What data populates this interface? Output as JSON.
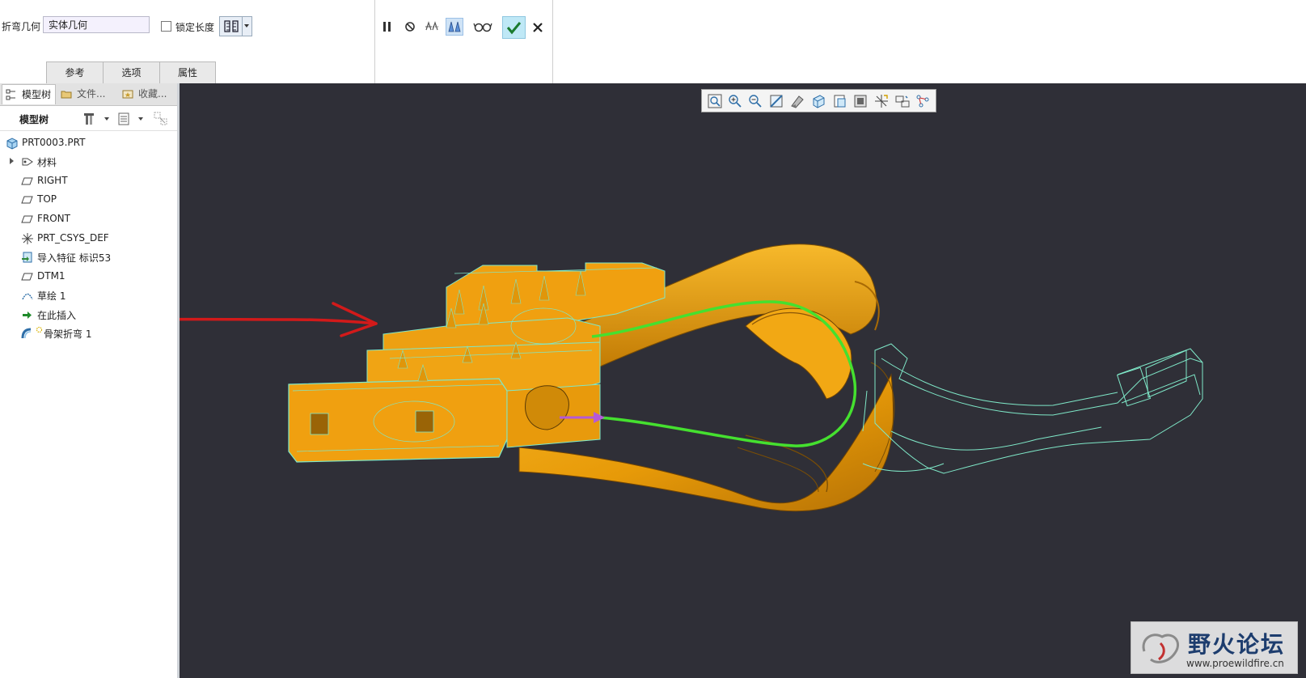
{
  "dashboard": {
    "geometry_label": "折弯几何",
    "geometry_value": "实体几何",
    "lock_length_label": "锁定长度",
    "tabs": [
      "参考",
      "选项",
      "属性"
    ]
  },
  "controls": {
    "pause": "pause-icon",
    "stop": "stop-icon",
    "preview": "preview-icon",
    "verify": "glasses-icon",
    "ok": "check-icon",
    "cancel": "close-icon"
  },
  "left_panel": {
    "tabs": [
      {
        "label": "模型树"
      },
      {
        "label": "文件..."
      },
      {
        "label": "收藏..."
      }
    ],
    "tree_header": "模型树",
    "tree_items": [
      {
        "label": "PRT0003.PRT",
        "icon": "part-icon"
      },
      {
        "label": "材料",
        "icon": "material-icon"
      },
      {
        "label": "RIGHT",
        "icon": "datum-plane-icon"
      },
      {
        "label": "TOP",
        "icon": "datum-plane-icon"
      },
      {
        "label": "FRONT",
        "icon": "datum-plane-icon"
      },
      {
        "label": "PRT_CSYS_DEF",
        "icon": "csys-icon"
      },
      {
        "label": "导入特征 标识53",
        "icon": "import-feature-icon"
      },
      {
        "label": "DTM1",
        "icon": "datum-plane-icon"
      },
      {
        "label": "草绘 1",
        "icon": "sketch-icon"
      },
      {
        "label": "在此插入",
        "icon": "insert-here-icon"
      },
      {
        "label": "骨架折弯 1",
        "icon": "spinal-bend-icon"
      }
    ]
  },
  "view_toolbar": [
    "refit-icon",
    "zoom-in-icon",
    "zoom-out-icon",
    "repaint-icon",
    "shading-icon",
    "saved-views-icon",
    "view-manager-icon",
    "display-style-icon",
    "datum-display-icon",
    "spin-center-icon",
    "annotation-icon"
  ],
  "colors": {
    "background": "#2f2f37",
    "part": "#f0a010",
    "wireframe": "#7fe8c8",
    "trajectory": "#4fe63a",
    "annotation_arrow": "#d21a1a"
  },
  "watermark": {
    "title": "野火论坛",
    "url": "www.proewildfire.cn"
  }
}
